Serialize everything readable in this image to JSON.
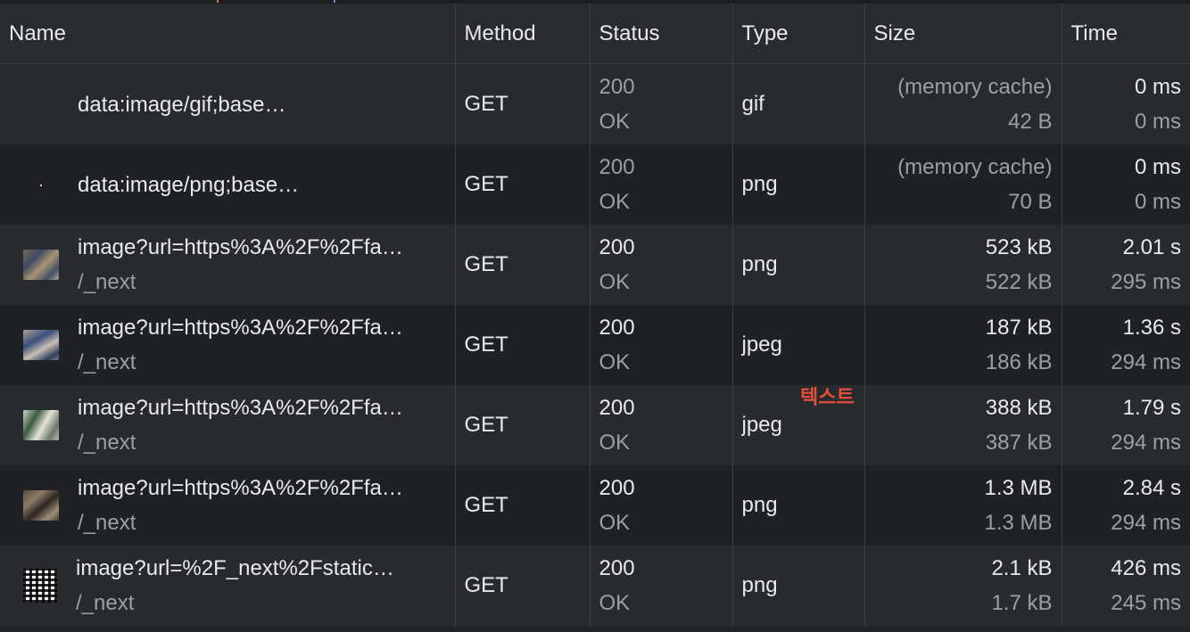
{
  "columns": {
    "name": "Name",
    "method": "Method",
    "status": "Status",
    "type": "Type",
    "size": "Size",
    "time": "Time"
  },
  "rows": [
    {
      "thumb": "empty",
      "name": "data:image/gif;base…",
      "initiator": "",
      "method": "GET",
      "status_code": "200",
      "status_text": "OK",
      "type": "gif",
      "size": "(memory cache)",
      "size_resource": "42 B",
      "time": "0 ms",
      "latency": "0 ms"
    },
    {
      "thumb": "dot",
      "name": "data:image/png;base…",
      "initiator": "",
      "method": "GET",
      "status_code": "200",
      "status_text": "OK",
      "type": "png",
      "size": "(memory cache)",
      "size_resource": "70 B",
      "time": "0 ms",
      "latency": "0 ms"
    },
    {
      "thumb": "p1",
      "name": "image?url=https%3A%2F%2Ffa…",
      "initiator": "/_next",
      "method": "GET",
      "status_code": "200",
      "status_text": "OK",
      "type": "png",
      "size": "523 kB",
      "size_resource": "522 kB",
      "time": "2.01 s",
      "latency": "295 ms"
    },
    {
      "thumb": "p2",
      "name": "image?url=https%3A%2F%2Ffa…",
      "initiator": "/_next",
      "method": "GET",
      "status_code": "200",
      "status_text": "OK",
      "type": "jpeg",
      "size": "187 kB",
      "size_resource": "186 kB",
      "time": "1.36 s",
      "latency": "294 ms"
    },
    {
      "thumb": "p3",
      "name": "image?url=https%3A%2F%2Ffa…",
      "initiator": "/_next",
      "method": "GET",
      "status_code": "200",
      "status_text": "OK",
      "type": "jpeg",
      "size": "388 kB",
      "size_resource": "387 kB",
      "time": "1.79 s",
      "latency": "294 ms"
    },
    {
      "thumb": "p4",
      "name": "image?url=https%3A%2F%2Ffa…",
      "initiator": "/_next",
      "method": "GET",
      "status_code": "200",
      "status_text": "OK",
      "type": "png",
      "size": "1.3 MB",
      "size_resource": "1.3 MB",
      "time": "2.84 s",
      "latency": "294 ms"
    },
    {
      "thumb": "qr",
      "name": "image?url=%2F_next%2Fstatic…",
      "initiator": "/_next",
      "method": "GET",
      "status_code": "200",
      "status_text": "OK",
      "type": "png",
      "size": "2.1 kB",
      "size_resource": "1.7 kB",
      "time": "426 ms",
      "latency": "245 ms"
    }
  ],
  "overlay_label": "텍스트",
  "colors": {
    "background": "#242528",
    "header": "#2a2b2e",
    "row_odd": "#292a2d",
    "row_even": "#202124",
    "text": "#e8eaed",
    "muted": "#9aa0a6",
    "overlay": "#e34f3c"
  }
}
